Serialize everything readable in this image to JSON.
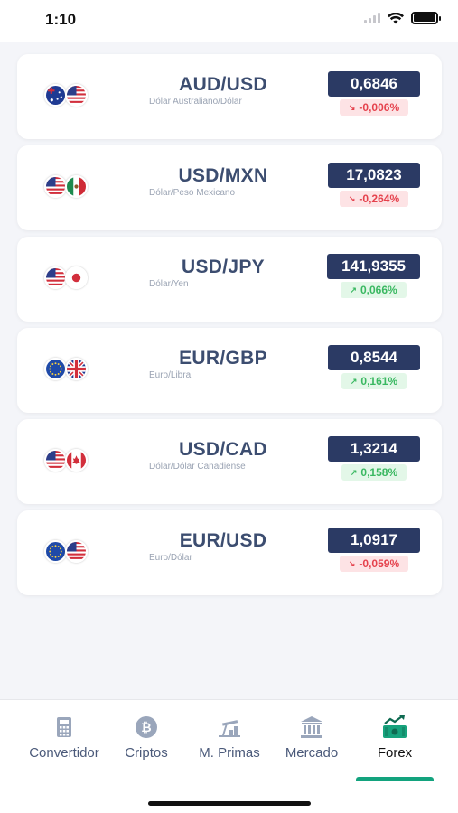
{
  "status_bar": {
    "time": "1:10"
  },
  "pairs": [
    {
      "name": "AUD/USD",
      "desc": "Dólar Australiano/Dólar",
      "price": "0,6846",
      "change": "-0,006%",
      "direction": "down",
      "flags": [
        "australia-flag",
        "usa-flag"
      ]
    },
    {
      "name": "USD/MXN",
      "desc": "Dólar/Peso Mexicano",
      "price": "17,0823",
      "change": "-0,264%",
      "direction": "down",
      "flags": [
        "usa-flag",
        "mexico-flag"
      ]
    },
    {
      "name": "USD/JPY",
      "desc": "Dólar/Yen",
      "price": "141,9355",
      "change": "0,066%",
      "direction": "up",
      "flags": [
        "usa-flag",
        "japan-flag"
      ]
    },
    {
      "name": "EUR/GBP",
      "desc": "Euro/Libra",
      "price": "0,8544",
      "change": "0,161%",
      "direction": "up",
      "flags": [
        "eu-flag",
        "uk-flag"
      ]
    },
    {
      "name": "USD/CAD",
      "desc": "Dólar/Dólar Canadiense",
      "price": "1,3214",
      "change": "0,158%",
      "direction": "up",
      "flags": [
        "usa-flag",
        "canada-flag"
      ]
    },
    {
      "name": "EUR/USD",
      "desc": "Euro/Dólar",
      "price": "1,0917",
      "change": "-0,059%",
      "direction": "down",
      "flags": [
        "eu-flag",
        "usa-flag"
      ]
    }
  ],
  "colors": {
    "price_bg": "#2b3a64",
    "down": "#e5424d",
    "up": "#3ab861",
    "accent": "#13a37e"
  },
  "tabs": [
    {
      "label": "Convertidor",
      "icon": "calculator-icon"
    },
    {
      "label": "Criptos",
      "icon": "bitcoin-icon"
    },
    {
      "label": "M. Primas",
      "icon": "oil-pump-icon"
    },
    {
      "label": "Mercado",
      "icon": "bank-icon"
    },
    {
      "label": "Forex",
      "icon": "forex-icon",
      "active": true
    }
  ]
}
